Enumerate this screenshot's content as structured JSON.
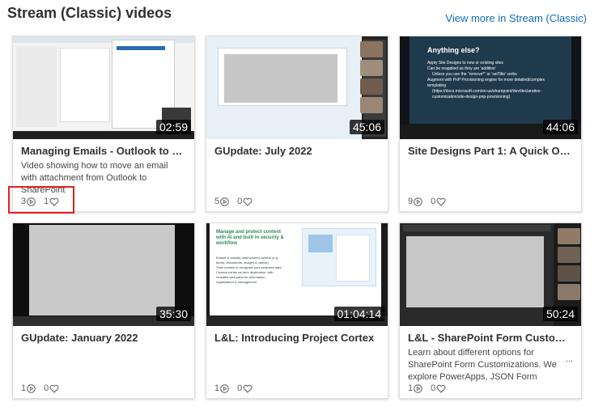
{
  "header": {
    "title": "Stream (Classic) videos",
    "view_more": "View more in Stream (Classic)"
  },
  "videos": [
    {
      "title": "Managing Emails - Outlook to Sh...",
      "description": "Video showing how to move an email with attachment from Outlook to SharePoint",
      "duration": "02:59",
      "views": "3",
      "likes": "1"
    },
    {
      "title": "GUpdate: July 2022",
      "description": "",
      "duration": "45:06",
      "views": "5",
      "likes": "0"
    },
    {
      "title": "Site Designs Part 1: A Quick Over...",
      "description": "",
      "duration": "44:06",
      "views": "9",
      "likes": "0",
      "slide": {
        "heading": "Anything else?",
        "bullets": [
          "Apply Site Designs to new or existing sites",
          "Can be reapplied as they are 'additive'",
          "Unless you use the \"remove*\" or 'setTitle' verbs",
          "Augment with PnP Provisioning engine for more detailed/complex templating",
          "(https://docs.microsoft.com/en-us/sharepoint/dev/declarative-customization/site-design-pnp-provisioning)"
        ]
      }
    },
    {
      "title": "GUpdate: January 2022",
      "description": "",
      "duration": "35:30",
      "views": "1",
      "likes": "0"
    },
    {
      "title": "L&L: Introducing Project Cortex",
      "description": "",
      "duration": "01:04:14",
      "views": "1",
      "likes": "0",
      "slide": {
        "heading": "Manage and protect content with AI and built in security & workflow",
        "bullets": [
          "Extract & classify unstructured content (e.g. forms, documents, images & videos)",
          "Train models to recognize your business data",
          "Content center as hero destination, with reusable web parts for information, organisation & management"
        ]
      }
    },
    {
      "title": "L&L - SharePoint Form Customiza...",
      "description": "Learn about different options for SharePoint Form Customizations. We explore PowerApps, JSON Form",
      "duration": "50:24",
      "views": "1",
      "likes": "0"
    }
  ],
  "more_indicator": "...",
  "colors": {
    "link": "#0f6cbd",
    "highlight": "#e02020",
    "slide_dark": "#1f3a4d",
    "accent": "#f2c12e"
  }
}
